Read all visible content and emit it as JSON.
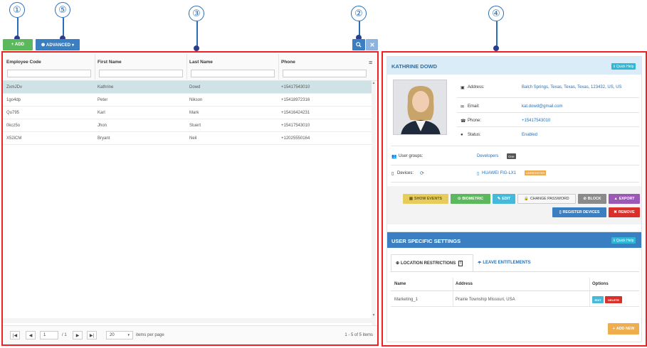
{
  "callouts": [
    "①",
    "⑤",
    "③",
    "②",
    "④"
  ],
  "toolbar": {
    "add_label": "+ ADD",
    "advanced_label": "❶ ADVANCED ▾",
    "search_icon": "search-icon",
    "clear_icon": "close-icon"
  },
  "grid": {
    "columns": [
      "Employee Code",
      "First Name",
      "Last Name",
      "Phone"
    ],
    "rows": [
      [
        "ZxmJDv",
        "Kathrine",
        "Dowd",
        "+15417543010"
      ],
      [
        "1go4dp",
        "Peter",
        "Nikson",
        "+15418972316"
      ],
      [
        "Qu795",
        "Karl",
        "Mark",
        "+15416424231"
      ],
      [
        "0kcz5o",
        "Jhon",
        "Stuert",
        "+15417543010"
      ],
      [
        "X52iCM",
        "Bryant",
        "Neil",
        "+12025550164"
      ]
    ],
    "pager": {
      "page": "1",
      "of_pages": "/ 1",
      "page_size": "20",
      "items_per_page": "items per page",
      "summary": "1 - 5 of 5 items"
    }
  },
  "profile": {
    "name": "KATHRINE DOWD",
    "quick_help": "Quick Help",
    "address_label": "Address:",
    "address_value": "Balch Springs, Texas, Texas, Texas, 123432, US, US",
    "email_label": "Email:",
    "email_value": "kat.dowd@gmail.com",
    "phone_label": "Phone:",
    "phone_value": "+15417543010",
    "status_label": "Status:",
    "status_value": "Enabled",
    "user_groups_label": "User groups:",
    "user_groups_value": "Developers",
    "user_groups_badge": "One",
    "devices_label": "Devices:",
    "device_value": "HUAWEI FIG-LX1",
    "device_badge": "UNREGISTER"
  },
  "actions": {
    "show_events": "SHOW EVENTS",
    "biometric": "BIOMETRIC",
    "edit": "EDIT",
    "change_password": "CHANGE PASSWORD",
    "block": "BLOCK",
    "export": "EXPORT",
    "register_devices": "REGISTER DEVICES",
    "remove": "REMOVE"
  },
  "settings": {
    "title": "USER SPECIFIC SETTINGS",
    "quick_help": "Quick Help",
    "tabs": [
      "LOCATION RESTRICTIONS",
      "LEAVE ENTITLEMENTS"
    ],
    "columns": [
      "Name",
      "Address",
      "Options"
    ],
    "rows": [
      [
        "Marketing_1",
        "Prairie Township Missouri, USA"
      ]
    ],
    "edit_label": "EDIT",
    "delete_label": "DELETE",
    "add_new": "ADD NEW"
  },
  "colors": {
    "accent_blue": "#3a7fc1",
    "green": "#5cb85c",
    "red_border": "#e22222",
    "orange": "#f0ad4e"
  }
}
